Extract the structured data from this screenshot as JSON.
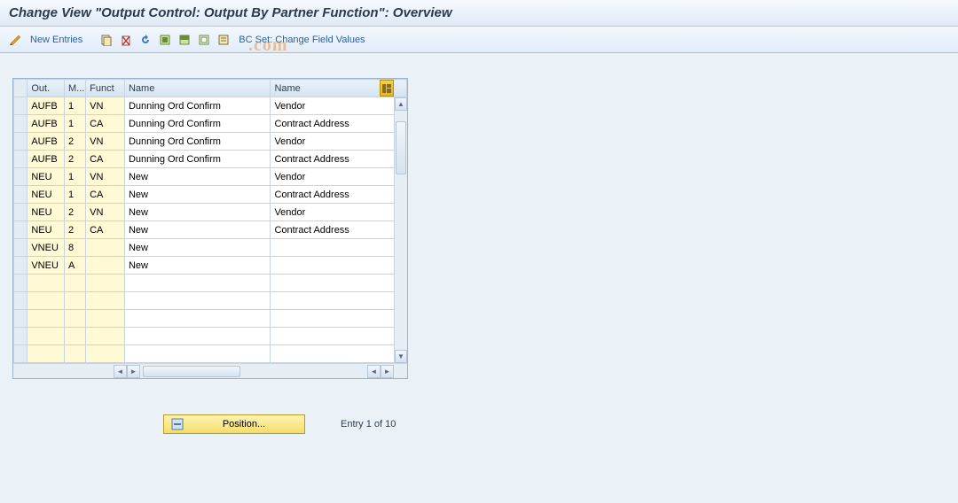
{
  "title": "Change View \"Output Control: Output By Partner Function\": Overview",
  "toolbar": {
    "new_entries": "New Entries",
    "bc_set": "BC Set: Change Field Values"
  },
  "watermark": ".com",
  "table": {
    "headers": {
      "out": "Out.",
      "m": "M...",
      "funct": "Funct",
      "name1": "Name",
      "name2": "Name"
    },
    "rows": [
      {
        "out": "AUFB",
        "m": "1",
        "funct": "VN",
        "name1": "Dunning Ord Confirm",
        "name2": "Vendor"
      },
      {
        "out": "AUFB",
        "m": "1",
        "funct": "CA",
        "name1": "Dunning Ord Confirm",
        "name2": "Contract Address"
      },
      {
        "out": "AUFB",
        "m": "2",
        "funct": "VN",
        "name1": "Dunning Ord Confirm",
        "name2": "Vendor"
      },
      {
        "out": "AUFB",
        "m": "2",
        "funct": "CA",
        "name1": "Dunning Ord Confirm",
        "name2": "Contract Address"
      },
      {
        "out": "NEU",
        "m": "1",
        "funct": "VN",
        "name1": "New",
        "name2": "Vendor"
      },
      {
        "out": "NEU",
        "m": "1",
        "funct": "CA",
        "name1": "New",
        "name2": "Contract Address"
      },
      {
        "out": "NEU",
        "m": "2",
        "funct": "VN",
        "name1": "New",
        "name2": "Vendor"
      },
      {
        "out": "NEU",
        "m": "2",
        "funct": "CA",
        "name1": "New",
        "name2": "Contract Address"
      },
      {
        "out": "VNEU",
        "m": "8",
        "funct": "",
        "name1": "New",
        "name2": ""
      },
      {
        "out": "VNEU",
        "m": "A",
        "funct": "",
        "name1": "New",
        "name2": ""
      }
    ],
    "empty_rows": 5
  },
  "footer": {
    "position_label": "Position...",
    "entry_text": "Entry 1 of 10"
  }
}
